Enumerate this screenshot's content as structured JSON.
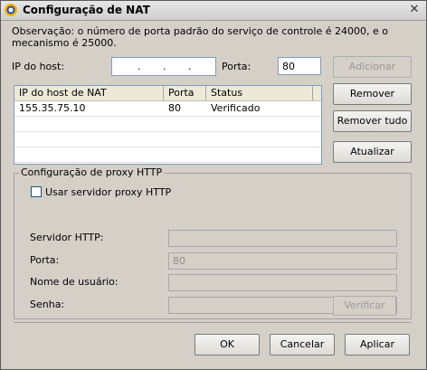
{
  "window": {
    "title": "Configuração de NAT",
    "close_glyph": "✕"
  },
  "note": "Observação: o número de porta padrão do serviço de controle é 24000, e o mecanismo é 25000.",
  "host": {
    "ip_label": "IP do host:",
    "ip_segments": [
      ".",
      ".",
      "."
    ],
    "port_label": "Porta:",
    "port_value": "80"
  },
  "buttons": {
    "add": "Adicionar",
    "remove": "Remover",
    "remove_all": "Remover tudo",
    "refresh": "Atualizar",
    "verify": "Verificar",
    "ok": "OK",
    "cancel": "Cancelar",
    "apply": "Aplicar"
  },
  "table": {
    "columns": [
      "IP do host de NAT",
      "Porta",
      "Status"
    ],
    "rows": [
      [
        "155.35.75.10",
        "80",
        "Verificado"
      ]
    ]
  },
  "proxy": {
    "group_title": "Configuração de proxy HTTP",
    "use_proxy_label": "Usar servidor proxy HTTP",
    "server_label": "Servidor HTTP:",
    "port_label": "Porta:",
    "port_value": "80",
    "user_label": "Nome de usuário:",
    "password_label": "Senha:"
  }
}
